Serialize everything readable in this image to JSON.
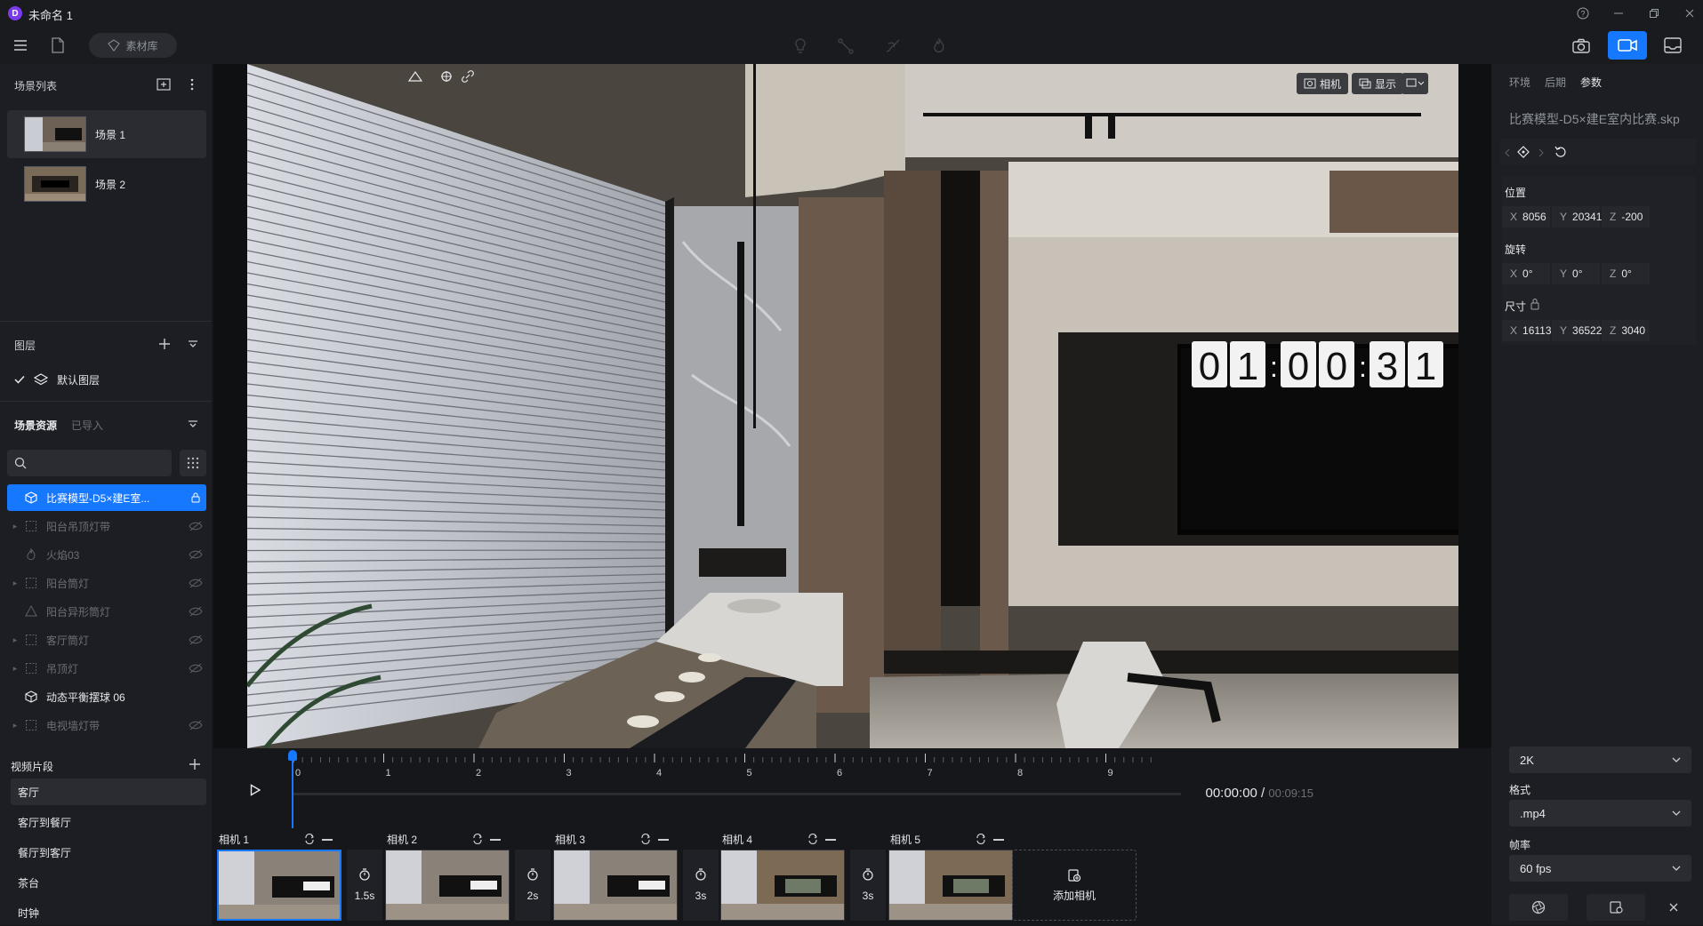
{
  "app": {
    "title": "未命名 1",
    "logo_letter": "D"
  },
  "toolbar": {
    "assets_label": "素材库"
  },
  "left": {
    "scene_list_title": "场景列表",
    "scenes": [
      {
        "label": "场景 1"
      },
      {
        "label": "场景 2"
      }
    ],
    "layers_title": "图层",
    "default_layer": "默认图层",
    "resources_title": "场景资源",
    "resources_tab_imported": "已导入",
    "assets": [
      {
        "label": "比赛模型-D5×建E室..."
      },
      {
        "label": "阳台吊顶灯带"
      },
      {
        "label": "火焰03"
      },
      {
        "label": "阳台筒灯"
      },
      {
        "label": "阳台异形筒灯"
      },
      {
        "label": "客厅筒灯"
      },
      {
        "label": "吊顶灯"
      },
      {
        "label": "动态平衡摆球 06"
      },
      {
        "label": "电视墙灯带"
      }
    ]
  },
  "viewport": {
    "camera_btn": "相机",
    "display_btn": "显示",
    "clock_text": [
      "01",
      "00",
      "31"
    ]
  },
  "right": {
    "tabs": [
      "环境",
      "后期",
      "参数"
    ],
    "file_name": "比赛模型-D5×建E室内比赛.skp",
    "position_label": "位置",
    "position": {
      "x": "8056",
      "y": "20341",
      "z": "-200"
    },
    "rotation_label": "旋转",
    "rotation": {
      "x": "0°",
      "y": "0°",
      "z": "0°"
    },
    "size_label": "尺寸",
    "size": {
      "x": "16113",
      "y": "36522",
      "z": "3040"
    },
    "resolution": "2K",
    "format_label": "格式",
    "format": ".mp4",
    "fps_label": "帧率",
    "fps": "60 fps"
  },
  "bottom": {
    "clips_title": "视频片段",
    "clips": [
      {
        "label": "客厅"
      },
      {
        "label": "客厅到餐厅"
      },
      {
        "label": "餐厅到客厅"
      },
      {
        "label": "茶台"
      },
      {
        "label": "时钟"
      }
    ],
    "ticks": [
      "0",
      "1",
      "2",
      "3",
      "4",
      "5",
      "6",
      "7",
      "8",
      "9"
    ],
    "time_current": "00:00:00",
    "time_sep": "/",
    "time_total": "00:09:15",
    "cameras": [
      {
        "label": "相机 1"
      },
      {
        "label": "相机 2"
      },
      {
        "label": "相机 3"
      },
      {
        "label": "相机 4"
      },
      {
        "label": "相机 5"
      }
    ],
    "durations": [
      "1.5s",
      "2s",
      "3s",
      "3s"
    ],
    "add_camera": "添加相机"
  }
}
